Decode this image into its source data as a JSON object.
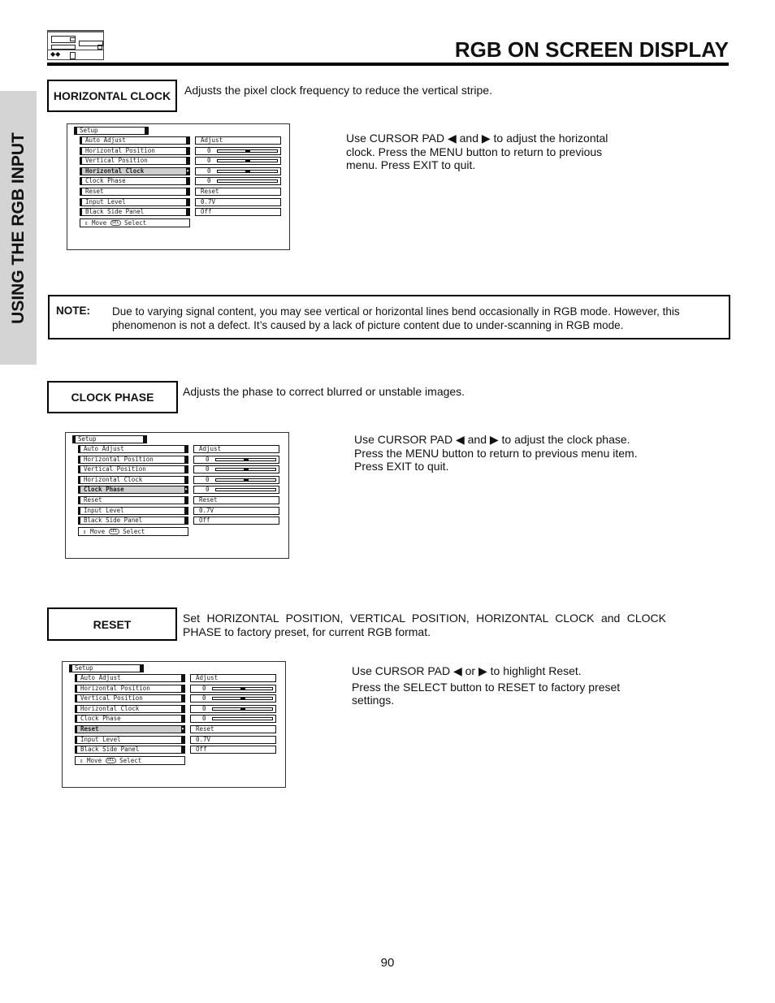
{
  "header": {
    "title": "RGB ON SCREEN DISPLAY",
    "logo_icon": "tv-device-icon"
  },
  "side_tab": {
    "label": "USING THE RGB INPUT"
  },
  "sections": [
    {
      "label": "HORIZONTAL CLOCK",
      "description": "Adjusts the pixel clock frequency to reduce the vertical stripe.",
      "instructions": [
        "Use CURSOR PAD ◀ and ▶ to adjust the horizontal clock.  Press the MENU button to return to previous menu.  Press EXIT to quit."
      ],
      "osd": {
        "title": "Setup",
        "selected_index": 3
      }
    },
    {
      "label": "CLOCK PHASE",
      "description": "Adjusts the phase to correct blurred or unstable images.",
      "instructions": [
        "Use CURSOR PAD ◀ and  ▶ to adjust the clock phase.",
        "Press the MENU button to return to previous menu item.",
        "Press EXIT to quit."
      ],
      "osd": {
        "title": "Setup",
        "selected_index": 4
      }
    },
    {
      "label": "RESET",
      "description": "Set  HORIZONTAL  POSITION,  VERTICAL  POSITION,  HORIZONTAL  CLOCK   and  CLOCK PHASE to factory preset, for current RGB format.",
      "instructions": [
        "Use CURSOR PAD ◀ or  ▶ to highlight Reset.",
        "Press the SELECT button to RESET to factory preset settings."
      ],
      "osd": {
        "title": "Setup",
        "selected_index": 5
      }
    }
  ],
  "osd_menu": {
    "items": [
      {
        "label": "Auto Adjust",
        "value": "Adjust",
        "type": "text"
      },
      {
        "label": "Horizontal Position",
        "value": "0",
        "type": "slider",
        "level": 0.5
      },
      {
        "label": "Vertical Position",
        "value": "0",
        "type": "slider",
        "level": 0.5
      },
      {
        "label": "Horizontal Clock",
        "value": "0",
        "type": "slider",
        "level": 0.5
      },
      {
        "label": "Clock Phase",
        "value": "0",
        "type": "slider",
        "level": null
      },
      {
        "label": "Reset",
        "value": "Reset",
        "type": "text"
      },
      {
        "label": "Input Level",
        "value": "0.7V",
        "type": "text"
      },
      {
        "label": "Black Side Panel",
        "value": "Off",
        "type": "text"
      }
    ],
    "footer": {
      "move": "Move",
      "sel_badge": "SEL",
      "select": "Select",
      "move_icon": "up-down-arrows-icon"
    }
  },
  "note": {
    "label": "NOTE:",
    "text": "Due to varying signal content, you may see vertical or horizontal lines bend occasionally in RGB mode.  However, this phenomenon is not a defect.  It’s caused by a lack of picture content due to under-scanning in RGB mode."
  },
  "page_number": "90"
}
